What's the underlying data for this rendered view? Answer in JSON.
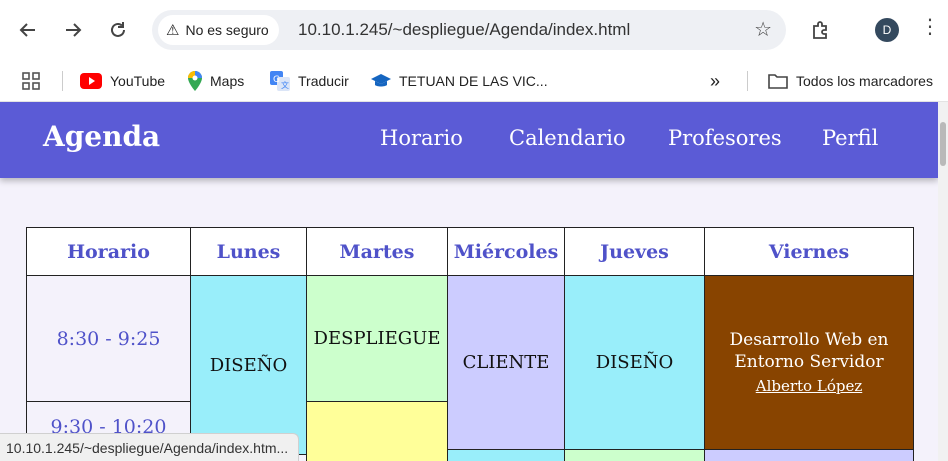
{
  "browser": {
    "security_label": "No es seguro",
    "url": "10.10.1.245/~despliegue/Agenda/index.html",
    "avatar_letter": "D",
    "status_url": "10.10.1.245/~despliegue/Agenda/index.htm...",
    "bookmarks": [
      {
        "label": "YouTube",
        "icon": "youtube-icon"
      },
      {
        "label": "Maps",
        "icon": "maps-pin-icon"
      },
      {
        "label": "Traducir",
        "icon": "translate-icon"
      },
      {
        "label": "TETUAN DE LAS VIC...",
        "icon": "graduation-cap-icon"
      }
    ],
    "all_bookmarks_label": "Todos los marcadores",
    "more_label": "»"
  },
  "site": {
    "title": "Agenda",
    "nav": [
      "Horario",
      "Calendario",
      "Profesores",
      "Perfil"
    ],
    "header_color": "#5b5bd6"
  },
  "schedule": {
    "headers": [
      "Horario",
      "Lunes",
      "Martes",
      "Miércoles",
      "Jueves",
      "Viernes"
    ],
    "times": [
      "8:30 - 9:25",
      "9:30 - 10:20"
    ],
    "subjects": {
      "lunes": "DISEÑO",
      "martes_1": "DESPLIEGUE",
      "miercoles": "CLIENTE",
      "jueves": "DISEÑO",
      "viernes": "Desarrollo Web en Entorno Servidor",
      "viernes_teacher": "Alberto López"
    },
    "colors": {
      "diseno": "#99eefa",
      "despliegue": "#ccffcc",
      "cliente": "#ccccff",
      "yellow": "#ffff99",
      "servidor": "#884400"
    }
  }
}
